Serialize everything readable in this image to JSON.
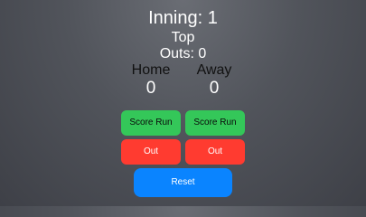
{
  "game": {
    "inning_text": "Inning: 1",
    "half_text": "Top",
    "outs_text": "Outs: 0"
  },
  "teams": {
    "home": {
      "label": "Home",
      "score": "0"
    },
    "away": {
      "label": "Away",
      "score": "0"
    }
  },
  "buttons": {
    "score_run_label": "Score Run",
    "out_label": "Out",
    "reset_label": "Reset"
  },
  "colors": {
    "score_run": "#34c759",
    "out": "#ff3b30",
    "reset": "#0a84ff"
  }
}
